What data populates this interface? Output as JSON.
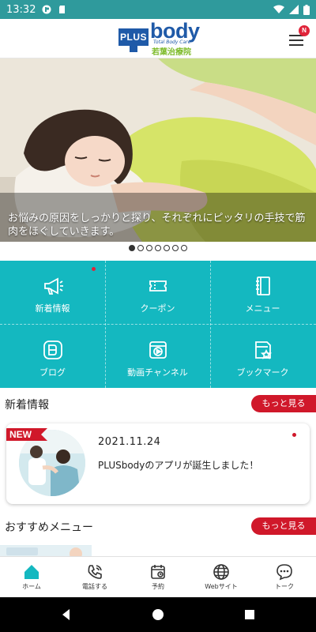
{
  "status_bar": {
    "time": "13:32"
  },
  "header": {
    "logo_plus": "PLUS",
    "logo_body": "body",
    "logo_sub": "Total Body Care",
    "logo_clinic": "若葉治療院",
    "menu_badge": "N"
  },
  "hero": {
    "caption": "お悩みの原因をしっかりと探り、それぞれにピッタリの手技で筋肉をほぐしていきます。",
    "slide_count": 7,
    "active_slide": 1
  },
  "menu_grid": [
    {
      "label": "新着情報",
      "icon": "megaphone-icon"
    },
    {
      "label": "クーポン",
      "icon": "coupon-icon"
    },
    {
      "label": "メニュー",
      "icon": "menu-book-icon"
    },
    {
      "label": "ブログ",
      "icon": "blog-icon"
    },
    {
      "label": "動画チャンネル",
      "icon": "video-icon"
    },
    {
      "label": "ブックマーク",
      "icon": "bookmark-icon"
    }
  ],
  "news": {
    "title": "新着情報",
    "more": "もっと見る",
    "badge": "NEW",
    "date": "2021.11.24",
    "text": "PLUSbodyのアプリが誕生しました！"
  },
  "recommend": {
    "title": "おすすめメニュー",
    "more": "もっと見る"
  },
  "tabbar": [
    {
      "label": "ホーム",
      "icon": "home-icon"
    },
    {
      "label": "電話する",
      "icon": "phone-icon"
    },
    {
      "label": "予約",
      "icon": "calendar-icon"
    },
    {
      "label": "Webサイト",
      "icon": "globe-icon"
    },
    {
      "label": "トーク",
      "icon": "chat-icon"
    }
  ],
  "colors": {
    "teal": "#14b8c0",
    "status_bar": "#2f9a9c",
    "red": "#d0182a",
    "brand_blue": "#1f5aa8",
    "brand_green": "#7dbb2a"
  }
}
